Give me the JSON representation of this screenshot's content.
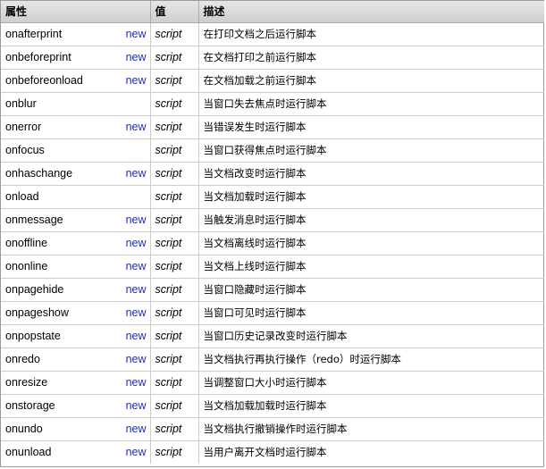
{
  "header": {
    "col_attribute": "属性",
    "col_value": "值",
    "col_description": "描述"
  },
  "rows": [
    {
      "attr": "onafterprint",
      "new": "new",
      "value": "script",
      "desc": "在打印文档之后运行脚本"
    },
    {
      "attr": "onbeforeprint",
      "new": "new",
      "value": "script",
      "desc": "在文档打印之前运行脚本"
    },
    {
      "attr": "onbeforeonload",
      "new": "new",
      "value": "script",
      "desc": "在文档加载之前运行脚本"
    },
    {
      "attr": "onblur",
      "new": "",
      "value": "script",
      "desc": "当窗口失去焦点时运行脚本"
    },
    {
      "attr": "onerror",
      "new": "new",
      "value": "script",
      "desc": "当错误发生时运行脚本"
    },
    {
      "attr": "onfocus",
      "new": "",
      "value": "script",
      "desc": "当窗口获得焦点时运行脚本"
    },
    {
      "attr": "onhaschange",
      "new": "new",
      "value": "script",
      "desc": "当文档改变时运行脚本"
    },
    {
      "attr": "onload",
      "new": "",
      "value": "script",
      "desc": "当文档加载时运行脚本"
    },
    {
      "attr": "onmessage",
      "new": "new",
      "value": "script",
      "desc": "当触发消息时运行脚本"
    },
    {
      "attr": "onoffline",
      "new": "new",
      "value": "script",
      "desc": "当文档离线时运行脚本"
    },
    {
      "attr": "ononline",
      "new": "new",
      "value": "script",
      "desc": "当文档上线时运行脚本"
    },
    {
      "attr": "onpagehide",
      "new": "new",
      "value": "script",
      "desc": "当窗口隐藏时运行脚本"
    },
    {
      "attr": "onpageshow",
      "new": "new",
      "value": "script",
      "desc": "当窗口可见时运行脚本"
    },
    {
      "attr": "onpopstate",
      "new": "new",
      "value": "script",
      "desc": "当窗口历史记录改变时运行脚本"
    },
    {
      "attr": "onredo",
      "new": "new",
      "value": "script",
      "desc": "当文档执行再执行操作（redo）时运行脚本"
    },
    {
      "attr": "onresize",
      "new": "new",
      "value": "script",
      "desc": "当调整窗口大小时运行脚本"
    },
    {
      "attr": "onstorage",
      "new": "new",
      "value": "script",
      "desc": "当文档加载加载时运行脚本"
    },
    {
      "attr": "onundo",
      "new": "new",
      "value": "script",
      "desc": "当文档执行撤销操作时运行脚本"
    },
    {
      "attr": "onunload",
      "new": "new",
      "value": "script",
      "desc": "当用户离开文档时运行脚本"
    }
  ],
  "colors": {
    "new_badge": "#1a2fbf",
    "header_bg": "#d4d4d4",
    "grid_line": "#cccccc"
  }
}
